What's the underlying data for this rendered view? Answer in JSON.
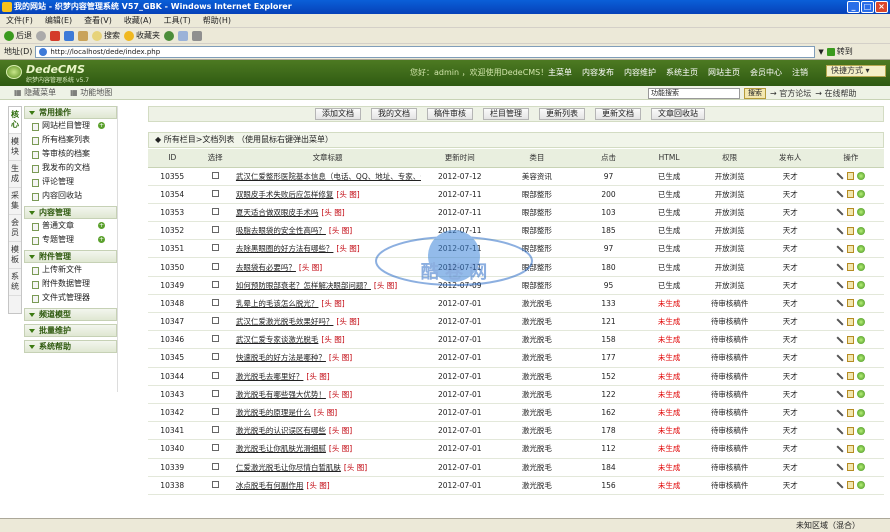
{
  "window": {
    "title": "我的网站 - 织梦内容管理系统 V57_GBK - Windows Internet Explorer"
  },
  "menu": [
    "文件(F)",
    "编辑(E)",
    "查看(V)",
    "收藏(A)",
    "工具(T)",
    "帮助(H)"
  ],
  "toolbar": {
    "back": "后退",
    "search": "搜索",
    "favorites": "收藏夹"
  },
  "address": {
    "label": "地址(D)",
    "url": "http://localhost/dede/index.php",
    "go": "转到"
  },
  "dede": {
    "logo": "DedeCMS",
    "logo_sub": "织梦内容管理系统",
    "version": "v5.7",
    "welcome": "您好：admin ，欢迎使用DedeCMS！",
    "nav": [
      "主菜单",
      "内容发布",
      "内容维护",
      "系统主页",
      "网站主页",
      "会员中心",
      "注销"
    ],
    "quick": "快捷方式"
  },
  "subbar": {
    "hide_menu": "隐藏菜单",
    "func_map": "功能地图",
    "search_placeholder": "功能搜索",
    "search_btn": "搜索",
    "official": "官方论坛",
    "online_help": "在线帮助"
  },
  "vtabs": [
    "核心",
    "模块",
    "生成",
    "采集",
    "会员",
    "模板",
    "系统"
  ],
  "sidebar": {
    "sections": [
      {
        "title": "常用操作",
        "items": [
          {
            "label": "网站栏目管理",
            "plus": true
          },
          {
            "label": "所有档案列表",
            "plus": false
          },
          {
            "label": "等审核的档案",
            "plus": false
          },
          {
            "label": "我发布的文档",
            "plus": false
          },
          {
            "label": "评论管理",
            "plus": false
          },
          {
            "label": "内容回收站",
            "plus": false
          }
        ]
      },
      {
        "title": "内容管理",
        "items": [
          {
            "label": "普通文章",
            "plus": true
          },
          {
            "label": "专题管理",
            "plus": true
          }
        ]
      },
      {
        "title": "附件管理",
        "items": [
          {
            "label": "上传新文件",
            "plus": false
          },
          {
            "label": "附件数据管理",
            "plus": false
          },
          {
            "label": "文件式管理器",
            "plus": false
          }
        ]
      },
      {
        "title": "频道模型",
        "items": []
      },
      {
        "title": "批量维护",
        "items": []
      },
      {
        "title": "系统帮助",
        "items": []
      }
    ]
  },
  "buttons": [
    "添加文档",
    "我的文档",
    "稿件审核",
    "栏目管理",
    "更新列表",
    "更新文档",
    "文章回收站"
  ],
  "list_title": "所有栏目>文档列表 （使用鼠标右键弹出菜单）",
  "columns": [
    "ID",
    "选择",
    "文章标题",
    "更新时间",
    "类目",
    "点击",
    "HTML",
    "权限",
    "发布人",
    "操作"
  ],
  "rows": [
    {
      "id": "10355",
      "title": "武汉仁爱整形医院基本信息（电话、QQ、地址、专家、公交线路等）",
      "tag": "[头 特]",
      "date": "2012-07-12",
      "cat": "美容资讯",
      "clicks": "97",
      "html": "已生成",
      "perm": "开放浏览",
      "author": "天才"
    },
    {
      "id": "10354",
      "title": "双眼皮手术失败后应怎样修复",
      "tag": "[头 图]",
      "date": "2012-07-11",
      "cat": "眼部整形",
      "clicks": "200",
      "html": "已生成",
      "perm": "开放浏览",
      "author": "天才"
    },
    {
      "id": "10353",
      "title": "夏天适合做双眼皮手术吗",
      "tag": "[头 图]",
      "date": "2012-07-11",
      "cat": "眼部整形",
      "clicks": "103",
      "html": "已生成",
      "perm": "开放浏览",
      "author": "天才"
    },
    {
      "id": "10352",
      "title": "吸脂去眼袋的安全性高吗？",
      "tag": "[头 图]",
      "date": "2012-07-11",
      "cat": "眼部整形",
      "clicks": "185",
      "html": "已生成",
      "perm": "开放浏览",
      "author": "天才"
    },
    {
      "id": "10351",
      "title": "去除黑眼圈的好方法有哪些？",
      "tag": "[头 图]",
      "date": "2012-07-11",
      "cat": "眼部整形",
      "clicks": "97",
      "html": "已生成",
      "perm": "开放浏览",
      "author": "天才"
    },
    {
      "id": "10350",
      "title": "去眼袋有必要吗？",
      "tag": "[头 图]",
      "date": "2012-07-11",
      "cat": "眼部整形",
      "clicks": "180",
      "html": "已生成",
      "perm": "开放浏览",
      "author": "天才"
    },
    {
      "id": "10349",
      "title": "如何预防眼部衰老？怎样解决眼部问题？",
      "tag": "[头 图]",
      "date": "2012-07-09",
      "cat": "眼部整形",
      "clicks": "95",
      "html": "已生成",
      "perm": "开放浏览",
      "author": "天才"
    },
    {
      "id": "10348",
      "title": "乳晕上的毛该怎么脱光？",
      "tag": "[头 图]",
      "date": "2012-07-01",
      "cat": "激光脱毛",
      "clicks": "133",
      "html": "未生成",
      "perm": "待审核稿件",
      "author": "天才"
    },
    {
      "id": "10347",
      "title": "武汉仁爱激光脱毛效果好吗？",
      "tag": "[头 图]",
      "date": "2012-07-01",
      "cat": "激光脱毛",
      "clicks": "121",
      "html": "未生成",
      "perm": "待审核稿件",
      "author": "天才"
    },
    {
      "id": "10346",
      "title": "武汉仁爱专家谈激光脱毛",
      "tag": "[头 图]",
      "date": "2012-07-01",
      "cat": "激光脱毛",
      "clicks": "158",
      "html": "未生成",
      "perm": "待审核稿件",
      "author": "天才"
    },
    {
      "id": "10345",
      "title": "快速脱毛的好方法是哪种？",
      "tag": "[头 图]",
      "date": "2012-07-01",
      "cat": "激光脱毛",
      "clicks": "177",
      "html": "未生成",
      "perm": "待审核稿件",
      "author": "天才"
    },
    {
      "id": "10344",
      "title": "激光脱毛去哪里好？",
      "tag": "[头 图]",
      "date": "2012-07-01",
      "cat": "激光脱毛",
      "clicks": "152",
      "html": "未生成",
      "perm": "待审核稿件",
      "author": "天才"
    },
    {
      "id": "10343",
      "title": "激光脱毛有哪些强大优势！",
      "tag": "[头 图]",
      "date": "2012-07-01",
      "cat": "激光脱毛",
      "clicks": "122",
      "html": "未生成",
      "perm": "待审核稿件",
      "author": "天才"
    },
    {
      "id": "10342",
      "title": "激光脱毛的原理是什么",
      "tag": "[头 图]",
      "date": "2012-07-01",
      "cat": "激光脱毛",
      "clicks": "162",
      "html": "未生成",
      "perm": "待审核稿件",
      "author": "天才"
    },
    {
      "id": "10341",
      "title": "激光脱毛的认识误区有哪些",
      "tag": "[头 图]",
      "date": "2012-07-01",
      "cat": "激光脱毛",
      "clicks": "178",
      "html": "未生成",
      "perm": "待审核稿件",
      "author": "天才"
    },
    {
      "id": "10340",
      "title": "激光脱毛让你肌肤光滑细腻",
      "tag": "[头 图]",
      "date": "2012-07-01",
      "cat": "激光脱毛",
      "clicks": "112",
      "html": "未生成",
      "perm": "待审核稿件",
      "author": "天才"
    },
    {
      "id": "10339",
      "title": "仁爱激光脱毛让你尽情白皙肌肤",
      "tag": "[头 图]",
      "date": "2012-07-01",
      "cat": "激光脱毛",
      "clicks": "184",
      "html": "未生成",
      "perm": "待审核稿件",
      "author": "天才"
    },
    {
      "id": "10338",
      "title": "冰点脱毛有何副作用",
      "tag": "[头 图]",
      "date": "2012-07-01",
      "cat": "激光脱毛",
      "clicks": "156",
      "html": "未生成",
      "perm": "待审核稿件",
      "author": "天才"
    }
  ],
  "watermark": "酷 卷 网",
  "status": {
    "zone": "未知区域（混合）"
  }
}
